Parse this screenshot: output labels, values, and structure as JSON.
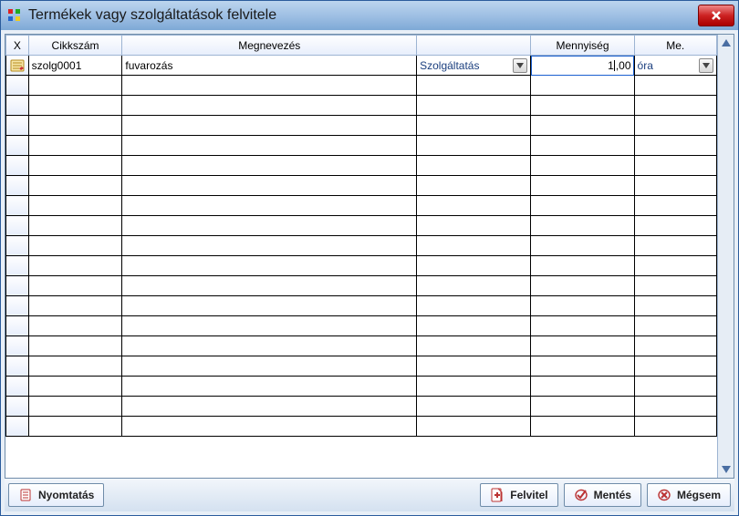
{
  "window": {
    "title": "Termékek vagy szolgáltatások felvitele"
  },
  "grid": {
    "columns": {
      "indicator": "X",
      "sku": "Cikkszám",
      "name": "Megnevezés",
      "type": "",
      "qty": "Mennyiség",
      "unit": "Me."
    },
    "row": {
      "sku": "szolg0001",
      "name": "fuvarozás",
      "type": "Szolgáltatás",
      "qty": "1,00",
      "unit": "óra"
    },
    "empty_rows": 18
  },
  "toolbar": {
    "print": "Nyomtatás",
    "add": "Felvitel",
    "save": "Mentés",
    "cancel": "Mégsem"
  }
}
